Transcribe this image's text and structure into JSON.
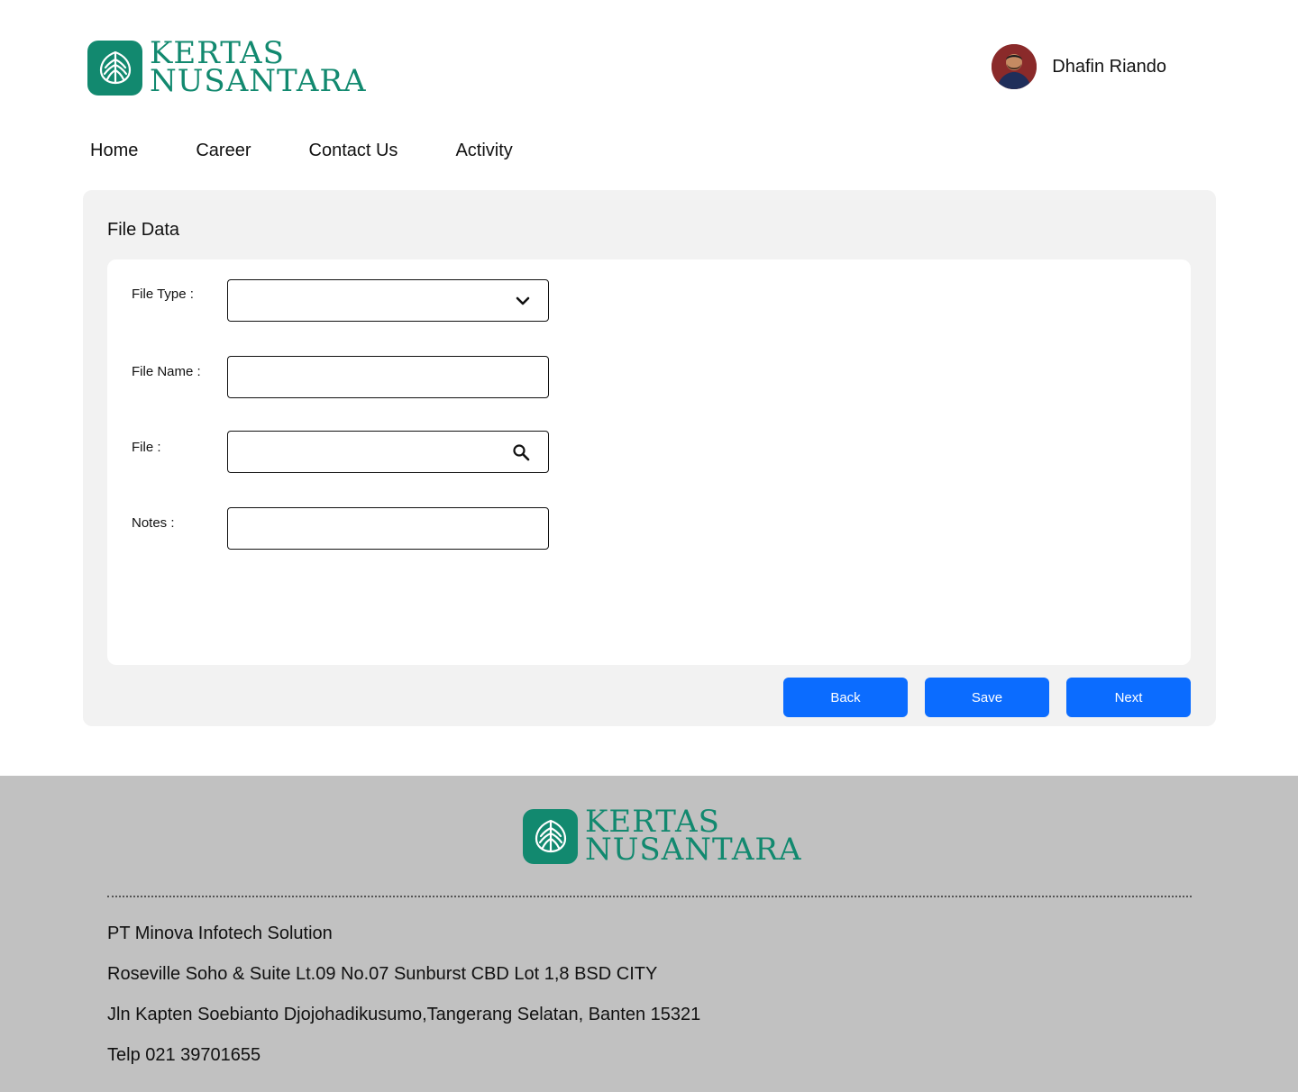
{
  "header": {
    "logo": {
      "line1": "KERTAS",
      "line2": "NUSANTARA"
    },
    "user": {
      "name": "Dhafin Riando",
      "avatar_icon": "user-avatar"
    }
  },
  "nav": {
    "items": [
      {
        "label": "Home"
      },
      {
        "label": "Career"
      },
      {
        "label": "Contact Us"
      },
      {
        "label": "Activity"
      }
    ]
  },
  "form": {
    "title": "File Data",
    "file_type": {
      "label": "File Type :",
      "value": "",
      "icon": "chevron-down-icon"
    },
    "file_name": {
      "label": "File Name :",
      "value": "",
      "placeholder": ""
    },
    "file": {
      "label": "File :",
      "value": "",
      "placeholder": "",
      "icon": "search-icon"
    },
    "notes": {
      "label": "Notes :",
      "value": "",
      "placeholder": ""
    },
    "buttons": {
      "back": "Back",
      "save": "Save",
      "next": "Next"
    }
  },
  "footer": {
    "logo": {
      "line1": "KERTAS",
      "line2": "NUSANTARA"
    },
    "company": "PT Minova Infotech Solution",
    "address1": "Roseville Soho & Suite Lt.09 No.07 Sunburst CBD Lot 1,8 BSD CITY",
    "address2": "Jln Kapten Soebianto Djojohadikusumo,Tangerang Selatan, Banten 15321",
    "phone": "Telp 021 39701655"
  },
  "colors": {
    "brand": "#12896f",
    "button": "#0b6cff",
    "card_bg": "#f2f2f2",
    "footer_bg": "#c1c1c1"
  }
}
